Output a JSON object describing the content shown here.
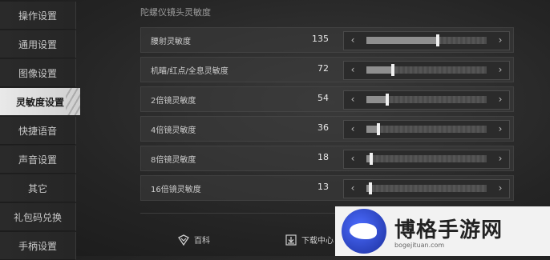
{
  "sidebar": {
    "items": [
      {
        "label": "操作设置"
      },
      {
        "label": "通用设置"
      },
      {
        "label": "图像设置"
      },
      {
        "label": "灵敏度设置",
        "active": true
      },
      {
        "label": "快捷语音"
      },
      {
        "label": "声音设置"
      },
      {
        "label": "其它"
      },
      {
        "label": "礼包码兑换"
      },
      {
        "label": "手柄设置"
      }
    ]
  },
  "section": {
    "title": "陀螺仪镜头灵敏度"
  },
  "rows": [
    {
      "label": "腰射灵敏度",
      "value": "135",
      "level": 0.59
    },
    {
      "label": "机瞄/红点/全息灵敏度",
      "value": "72",
      "level": 0.22
    },
    {
      "label": "2倍镜灵敏度",
      "value": "54",
      "level": 0.17
    },
    {
      "label": "4倍镜灵敏度",
      "value": "36",
      "level": 0.1
    },
    {
      "label": "8倍镜灵敏度",
      "value": "18",
      "level": 0.04
    },
    {
      "label": "16倍镜灵敏度",
      "value": "13",
      "level": 0.03
    }
  ],
  "controls": {
    "left_icon": "chevron-left-icon",
    "right_icon": "chevron-right-icon",
    "left_glyph": "‹",
    "right_glyph": "›"
  },
  "bottom": {
    "wiki_label": "百科",
    "download_label": "下载中心"
  },
  "watermark": {
    "title": "博格手游网",
    "url": "bogejituan.com"
  }
}
